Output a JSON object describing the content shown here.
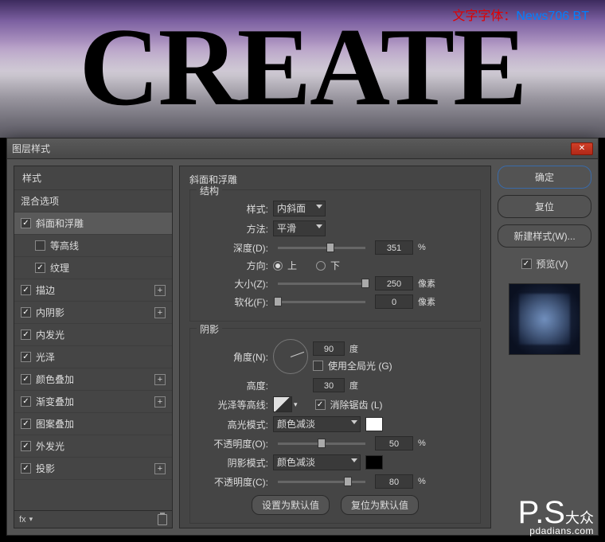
{
  "banner": {
    "create_text": "CREATE",
    "font_label_prefix": "文字字体：",
    "font_label_name": "News706 BT"
  },
  "dialog": {
    "title": "图层样式",
    "close": "✕"
  },
  "sidebar": {
    "header": "样式",
    "blending": "混合选项",
    "bevel": {
      "label": "斜面和浮雕",
      "checked": true,
      "selected": true
    },
    "contour_sub": {
      "label": "等高线",
      "checked": false
    },
    "texture_sub": {
      "label": "纹理",
      "checked": true
    },
    "stroke": {
      "label": "描边",
      "checked": true
    },
    "inner_shadow": {
      "label": "内阴影",
      "checked": true
    },
    "inner_glow": {
      "label": "内发光",
      "checked": true
    },
    "satin": {
      "label": "光泽",
      "checked": true
    },
    "color_overlay": {
      "label": "颜色叠加",
      "checked": true
    },
    "gradient_overlay": {
      "label": "渐变叠加",
      "checked": true
    },
    "pattern_overlay": {
      "label": "图案叠加",
      "checked": true
    },
    "outer_glow": {
      "label": "外发光",
      "checked": true
    },
    "drop_shadow": {
      "label": "投影",
      "checked": true
    },
    "fx": "fx"
  },
  "main": {
    "panel_title": "斜面和浮雕",
    "structure_title": "结构",
    "style": {
      "label": "样式:",
      "value": "内斜面"
    },
    "technique": {
      "label": "方法:",
      "value": "平滑"
    },
    "depth": {
      "label": "深度(D):",
      "value": "351",
      "unit": "%",
      "pos": 60
    },
    "direction": {
      "label": "方向:",
      "up": "上",
      "down": "下"
    },
    "size": {
      "label": "大小(Z):",
      "value": "250",
      "unit": "像素",
      "pos": 100
    },
    "soften": {
      "label": "软化(F):",
      "value": "0",
      "unit": "像素",
      "pos": 0
    },
    "shading_title": "阴影",
    "angle": {
      "label": "角度(N):",
      "value": "90",
      "unit": "度"
    },
    "global_light": {
      "label": "使用全局光 (G)",
      "checked": false
    },
    "altitude": {
      "label": "高度:",
      "value": "30",
      "unit": "度"
    },
    "gloss_contour": {
      "label": "光泽等高线:"
    },
    "antialias": {
      "label": "消除锯齿 (L)",
      "checked": true
    },
    "highlight_mode": {
      "label": "高光模式:",
      "value": "颜色减淡"
    },
    "highlight_opacity": {
      "label": "不透明度(O):",
      "value": "50",
      "unit": "%",
      "pos": 50
    },
    "shadow_mode": {
      "label": "阴影模式:",
      "value": "颜色减淡"
    },
    "shadow_opacity": {
      "label": "不透明度(C):",
      "value": "80",
      "unit": "%",
      "pos": 80
    },
    "make_default": "设置为默认值",
    "reset_default": "复位为默认值"
  },
  "right": {
    "ok": "确定",
    "reset": "复位",
    "new_style": "新建样式(W)...",
    "preview": "预览(V)"
  },
  "watermark": {
    "logo": "P.S",
    "sub": "大众",
    "url": "pdadians.com"
  }
}
